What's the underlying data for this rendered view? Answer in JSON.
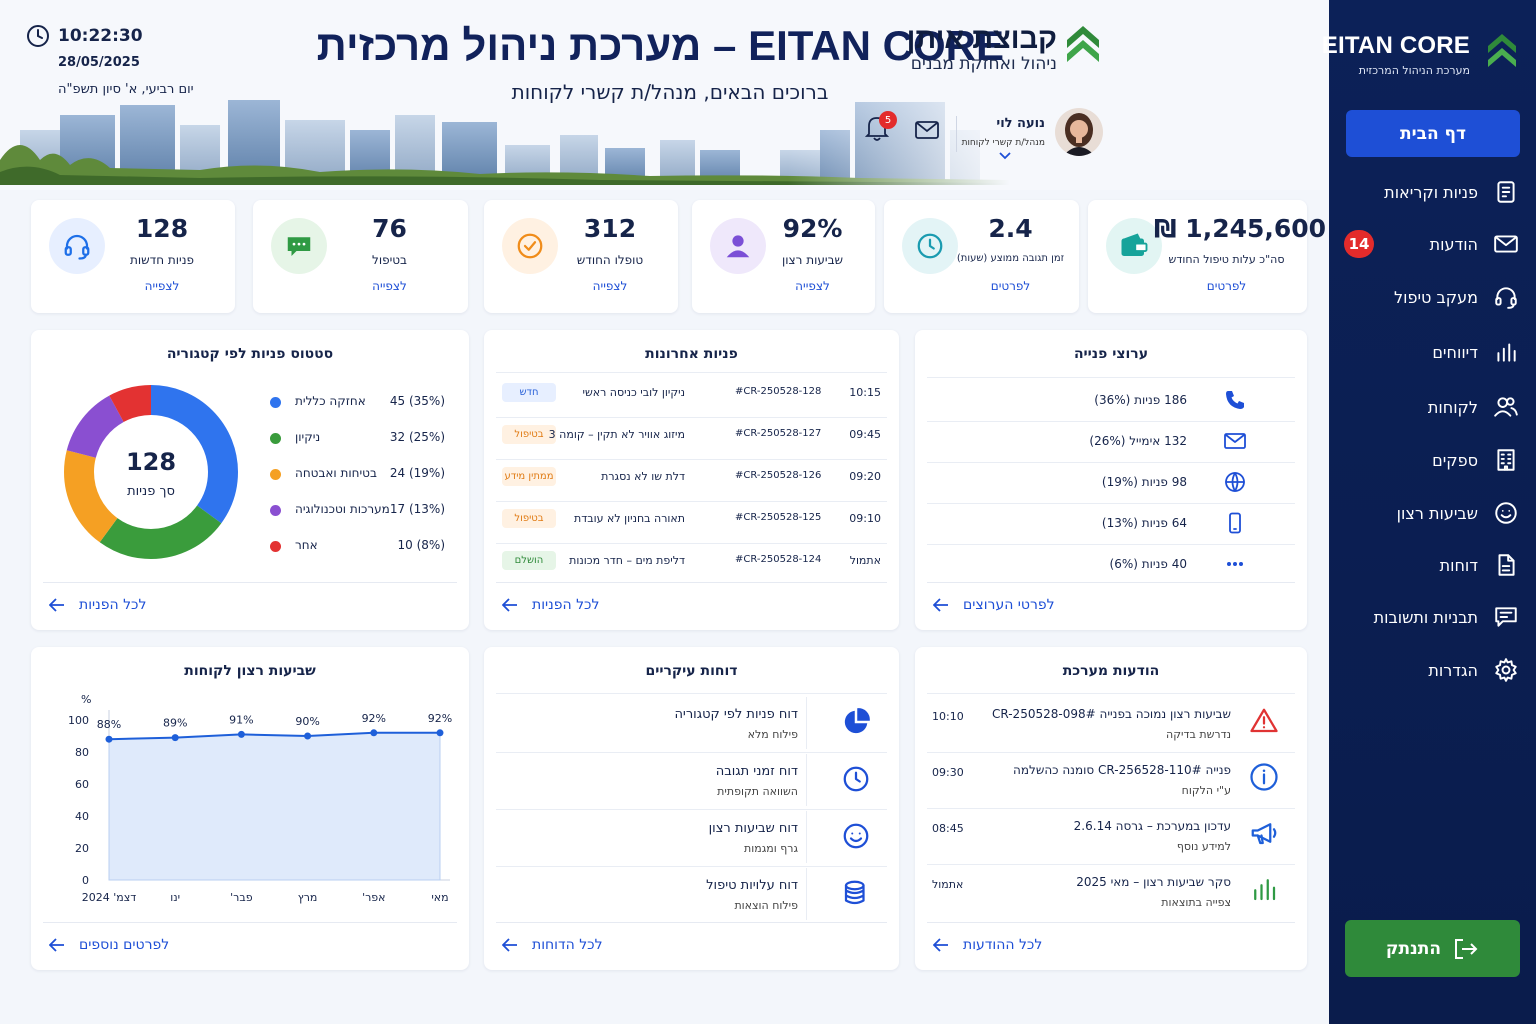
{
  "sidebar": {
    "brand_title": "EITAN CORE",
    "brand_subtitle": "מערכת הניהול המרכזית",
    "home_label": "דף הבית",
    "items": [
      {
        "label": "פניות וקריאות",
        "icon": "tickets-icon"
      },
      {
        "label": "הודעות",
        "icon": "mail-icon",
        "badge": "14"
      },
      {
        "label": "מעקב טיפול",
        "icon": "headset-icon"
      },
      {
        "label": "דיווחים",
        "icon": "bar-chart-icon"
      },
      {
        "label": "לקוחות",
        "icon": "users-icon"
      },
      {
        "label": "ספקים",
        "icon": "building-icon"
      },
      {
        "label": "שביעות רצון",
        "icon": "smile-icon"
      },
      {
        "label": "דוחות",
        "icon": "document-icon"
      },
      {
        "label": "תבניות ותשובות",
        "icon": "message-template-icon"
      },
      {
        "label": "הגדרות",
        "icon": "gear-icon"
      }
    ],
    "logout_label": "התנתק"
  },
  "header": {
    "time": "10:22:30",
    "date": "28/05/2025",
    "hebrew_date": "יום רביעי, א' סיון תשפ\"ה",
    "title": "EITAN CORE – מערכת  ניהול  מרכזית",
    "welcome": "ברוכים הבאים, מנהל/ת קשרי לקוחות",
    "company_name": "קבוצת איתן",
    "company_subtitle": "ניהול ואחזקת מבנים",
    "user_name": "נועה לוי",
    "user_role": "מנהל/ת קשרי לקוחות",
    "notifications_count": "5"
  },
  "stats": [
    {
      "value": "128",
      "label": "פניות חדשות",
      "link": "לצפייה",
      "icon": "headset-icon",
      "color": "#1e6fe8"
    },
    {
      "value": "76",
      "label": "בטיפול",
      "link": "לצפייה",
      "icon": "chat-icon",
      "color": "#2f9a44"
    },
    {
      "value": "312",
      "label": "טופלו החודש",
      "link": "לצפייה",
      "icon": "check-circle-icon",
      "color": "#f08c1a"
    },
    {
      "value": "92%",
      "label": "שביעות רצון",
      "link": "לצפייה",
      "icon": "user-icon",
      "color": "#7b4fd6"
    },
    {
      "value": "2.4",
      "label": "זמן תגובה ממוצע (שעות)",
      "link": "לפרטים",
      "icon": "clock-icon",
      "color": "#1a9bb0"
    },
    {
      "value": "₪ 1,245,600",
      "label": "סה\"כ עלות טיפול החודש",
      "link": "לפרטים",
      "icon": "wallet-icon",
      "color": "#16a39a"
    }
  ],
  "status_panel": {
    "title": "סטטוס פניות לפי קטגוריה",
    "center_value": "128",
    "center_label": "סך פניות",
    "footer_link": "לכל הפניות",
    "legend": [
      {
        "label": "אחזקה כללית",
        "value": "45 (35%)",
        "color": "#2f74ee",
        "share": 35
      },
      {
        "label": "ניקיון",
        "value": "32 (25%)",
        "color": "#3a9c3c",
        "share": 25
      },
      {
        "label": "בטיחות ואבטחה",
        "value": "24 (19%)",
        "color": "#f5a023",
        "share": 19
      },
      {
        "label": "מערכות וטכנולוגיה",
        "value": "17 (13%)",
        "color": "#8a4fd1",
        "share": 13
      },
      {
        "label": "אחר",
        "value": "10 (8%)",
        "color": "#e33232",
        "share": 8
      }
    ]
  },
  "recent_panel": {
    "title": "פניות אחרונות",
    "footer_link": "לכל הפניות",
    "rows": [
      {
        "time": "10:15",
        "id": "#CR-250528-128",
        "desc": "ניקיון לובי כניסה ראשי",
        "status": "חדש",
        "status_color": "#2a62d8",
        "status_bg": "#e7efff"
      },
      {
        "time": "09:45",
        "id": "#CR-250528-127",
        "desc": "מיזוג אוויר לא תקין – קומה 3",
        "status": "בטיפול",
        "status_color": "#e07b14",
        "status_bg": "#fff1e2"
      },
      {
        "time": "09:20",
        "id": "#CR-250528-126",
        "desc": "דלת שו לא נסגרת",
        "status": "ממתין מידע",
        "status_color": "#e07b14",
        "status_bg": "#fff1e2"
      },
      {
        "time": "09:10",
        "id": "#CR-250528-125",
        "desc": "תאורה בחניון לא עובדת",
        "status": "בטיפול",
        "status_color": "#e07b14",
        "status_bg": "#fff1e2"
      },
      {
        "time": "אתמול",
        "id": "#CR-250528-124",
        "desc": "דליפת מים – חדר מכונות",
        "status": "הושלם",
        "status_color": "#2f8a3a",
        "status_bg": "#e6f5e7"
      }
    ]
  },
  "channels_panel": {
    "title": "ערוצי פנייה",
    "footer_link": "לפרטי הערוצים",
    "rows": [
      {
        "text": "186 פניות (36%)",
        "icon": "phone-icon"
      },
      {
        "text": "132 אימייל (26%)",
        "icon": "mail-icon"
      },
      {
        "text": "98 פניות (19%)",
        "icon": "globe-icon"
      },
      {
        "text": "64 פניות (13%)",
        "icon": "mobile-icon"
      },
      {
        "text": "40 פניות (6%)",
        "icon": "more-icon"
      }
    ]
  },
  "satisfaction_panel": {
    "title": "שביעות רצון לקוחות",
    "footer_link": "לפרטים נוספים"
  },
  "chart_data": {
    "type": "area",
    "title": "שביעות רצון לקוחות",
    "ylabel": "%",
    "categories": [
      "מאי",
      "אפר'",
      "מרץ",
      "פבר'",
      "ינו",
      "דצמ' 2024"
    ],
    "values": [
      92,
      92,
      90,
      91,
      89,
      88
    ],
    "data_labels": [
      "92%",
      "92%",
      "90%",
      "91%",
      "89%",
      "88%"
    ],
    "ylim": [
      0,
      100
    ],
    "yticks": [
      "0",
      "20",
      "40",
      "60",
      "80",
      "100"
    ],
    "color": "#1e5fd9",
    "fill": "#dfeafb"
  },
  "reports_panel": {
    "title": "דוחות עיקריים",
    "footer_link": "לכל הדוחות",
    "rows": [
      {
        "title": "דוח פניות לפי קטגוריה",
        "sub": "פילוח מלא",
        "icon": "pie-chart-icon"
      },
      {
        "title": "דוח זמני תגובה",
        "sub": "השוואה תקופתית",
        "icon": "clock-icon"
      },
      {
        "title": "דוח שביעות רצון",
        "sub": "גרף ומגמות",
        "icon": "smile-icon"
      },
      {
        "title": "דוח עלויות טיפול",
        "sub": "פילוח הוצאות",
        "icon": "coins-icon"
      }
    ]
  },
  "system_panel": {
    "title": "הודעות מערכת",
    "footer_link": "לכל ההודעות",
    "rows": [
      {
        "time": "10:10",
        "title": "שביעות רצון נמוכה בפנייה #CR-250528-098",
        "sub": "נדרשת בדיקה",
        "icon": "warning-icon",
        "color": "#e03333"
      },
      {
        "time": "09:30",
        "title": "פנייה #CR-256528-110 סומנה כהשלמה",
        "sub": "ע\"י הלקוח",
        "icon": "info-icon",
        "color": "#1e5fd9"
      },
      {
        "time": "08:45",
        "title": "עדכון במערכת – גרסה 2.6.14",
        "sub": "למידע נוסף",
        "icon": "megaphone-icon",
        "color": "#1e5fd9"
      },
      {
        "time": "אתמול",
        "title": "סקר שביעות רצון – מאי 2025",
        "sub": "צפייה בתוצאות",
        "icon": "bar-chart-icon",
        "color": "#2f9a44"
      }
    ]
  }
}
